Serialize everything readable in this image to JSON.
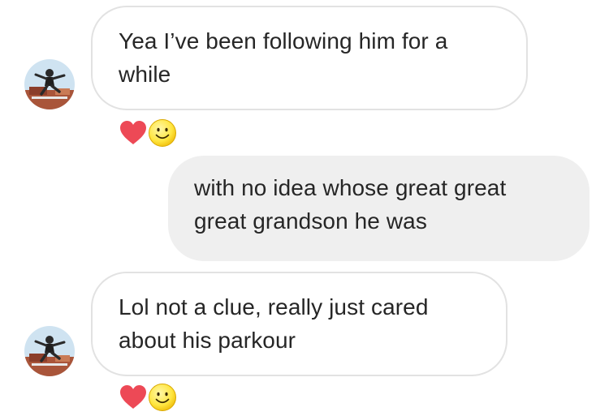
{
  "thread": {
    "messages": [
      {
        "sender": "other",
        "lines": [
          "Yea I’ve been following him for a",
          "while"
        ],
        "reactions": [
          "heart-icon",
          "smiley-icon"
        ]
      },
      {
        "sender": "me",
        "lines": [
          "with no idea whose great great",
          "great grandson he was"
        ],
        "reactions": []
      },
      {
        "sender": "other",
        "lines": [
          "Lol not a clue, really just cared",
          "about his parkour"
        ],
        "reactions": [
          "heart-icon",
          "smiley-icon"
        ]
      }
    ]
  },
  "colors": {
    "incoming_bubble_bg": "#ffffff",
    "incoming_bubble_border": "#e2e2e2",
    "outgoing_bubble_bg": "#efefef",
    "text": "#262626",
    "heart": "#ed4956",
    "smiley": "#ffe640"
  }
}
